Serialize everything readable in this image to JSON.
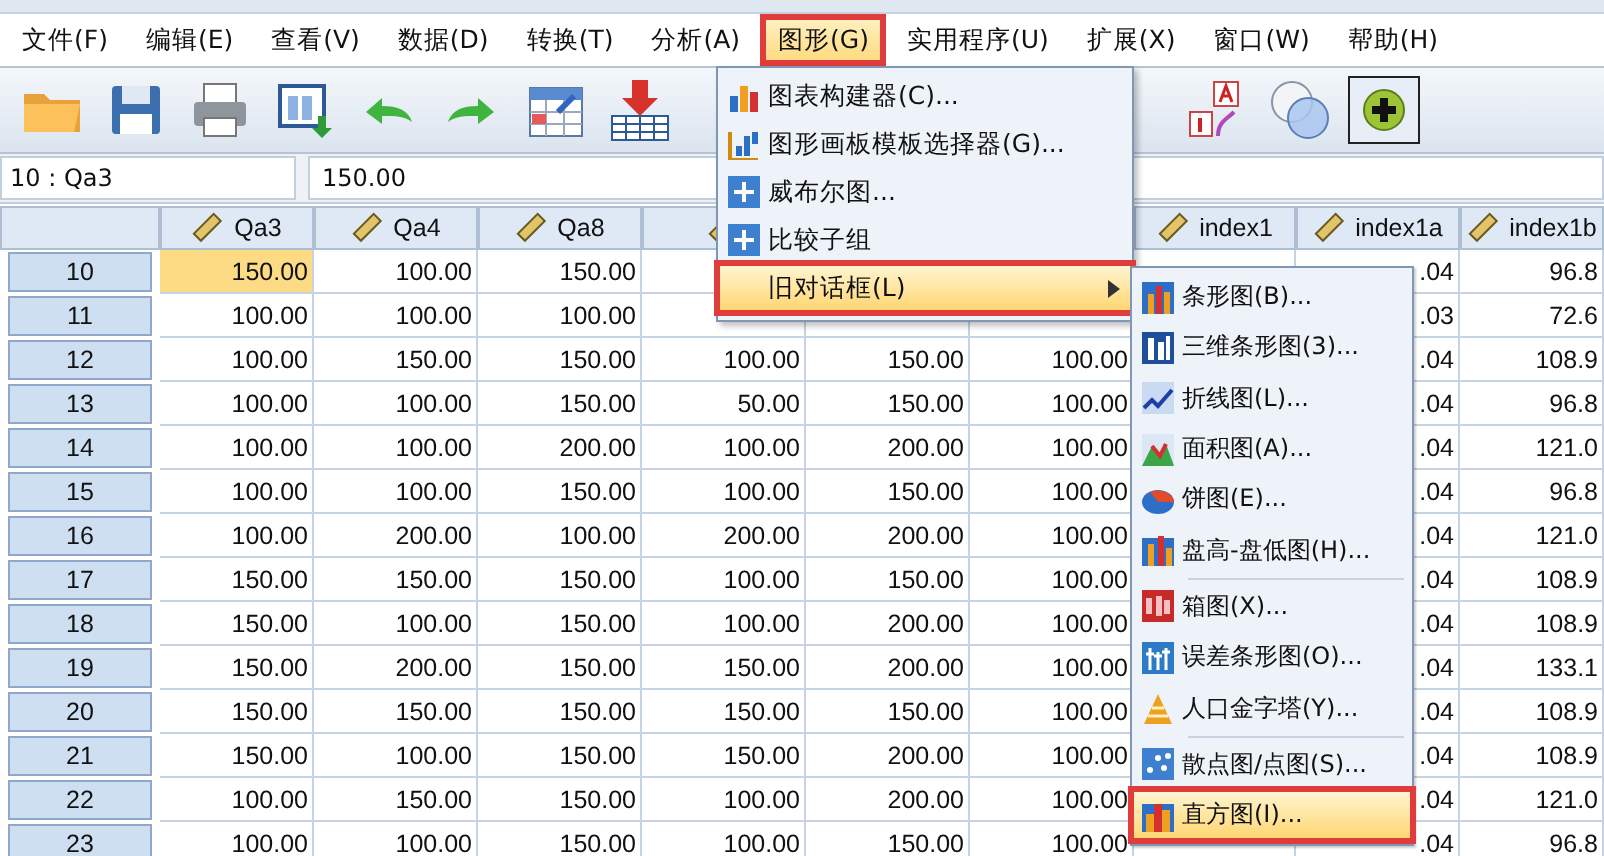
{
  "menu_bar": [
    {
      "label": "文件(F)",
      "selected": false,
      "outlined": false
    },
    {
      "label": "编辑(E)",
      "selected": false,
      "outlined": false
    },
    {
      "label": "查看(V)",
      "selected": false,
      "outlined": false
    },
    {
      "label": "数据(D)",
      "selected": false,
      "outlined": false
    },
    {
      "label": "转换(T)",
      "selected": false,
      "outlined": false
    },
    {
      "label": "分析(A)",
      "selected": false,
      "outlined": false
    },
    {
      "label": "图形(G)",
      "selected": true,
      "outlined": true
    },
    {
      "label": "实用程序(U)",
      "selected": false,
      "outlined": false
    },
    {
      "label": "扩展(X)",
      "selected": false,
      "outlined": false
    },
    {
      "label": "窗口(W)",
      "selected": false,
      "outlined": false
    },
    {
      "label": "帮助(H)",
      "selected": false,
      "outlined": false
    }
  ],
  "toolbar": {
    "add_on_pressed": true
  },
  "cell_bar": {
    "reference": "10 : Qa3",
    "value": "150.00"
  },
  "table": {
    "columns": [
      "Qa3",
      "Qa4",
      "Qa8",
      null,
      null,
      null,
      "index1",
      "index1a",
      "index1b"
    ],
    "rows": [
      {
        "label": "10",
        "cells": [
          {
            "text": "150.00",
            "selected": true
          },
          {
            "text": "100.00",
            "selected": false
          },
          {
            "text": "150.00",
            "selected": false
          },
          null,
          null,
          null,
          null,
          {
            "text": ".04",
            "selected": false
          },
          {
            "text": "96.8",
            "selected": false
          }
        ]
      },
      {
        "label": "11",
        "cells": [
          {
            "text": "100.00",
            "selected": false
          },
          {
            "text": "100.00",
            "selected": false
          },
          {
            "text": "100.00",
            "selected": false
          },
          null,
          null,
          null,
          null,
          {
            "text": ".03",
            "selected": false
          },
          {
            "text": "72.6",
            "selected": false
          }
        ]
      },
      {
        "label": "12",
        "cells": [
          {
            "text": "100.00",
            "selected": false
          },
          {
            "text": "150.00",
            "selected": false
          },
          {
            "text": "150.00",
            "selected": false
          },
          {
            "text": "100.00",
            "selected": false
          },
          {
            "text": "150.00",
            "selected": false
          },
          {
            "text": "100.00",
            "selected": false
          },
          null,
          {
            "text": ".04",
            "selected": false
          },
          {
            "text": "108.9",
            "selected": false
          }
        ]
      },
      {
        "label": "13",
        "cells": [
          {
            "text": "100.00",
            "selected": false
          },
          {
            "text": "100.00",
            "selected": false
          },
          {
            "text": "150.00",
            "selected": false
          },
          {
            "text": "50.00",
            "selected": false
          },
          {
            "text": "150.00",
            "selected": false
          },
          {
            "text": "100.00",
            "selected": false
          },
          null,
          {
            "text": ".04",
            "selected": false
          },
          {
            "text": "96.8",
            "selected": false
          }
        ]
      },
      {
        "label": "14",
        "cells": [
          {
            "text": "100.00",
            "selected": false
          },
          {
            "text": "100.00",
            "selected": false
          },
          {
            "text": "200.00",
            "selected": false
          },
          {
            "text": "100.00",
            "selected": false
          },
          {
            "text": "200.00",
            "selected": false
          },
          {
            "text": "100.00",
            "selected": false
          },
          null,
          {
            "text": ".04",
            "selected": false
          },
          {
            "text": "121.0",
            "selected": false
          }
        ]
      },
      {
        "label": "15",
        "cells": [
          {
            "text": "100.00",
            "selected": false
          },
          {
            "text": "100.00",
            "selected": false
          },
          {
            "text": "150.00",
            "selected": false
          },
          {
            "text": "100.00",
            "selected": false
          },
          {
            "text": "150.00",
            "selected": false
          },
          {
            "text": "100.00",
            "selected": false
          },
          null,
          {
            "text": ".04",
            "selected": false
          },
          {
            "text": "96.8",
            "selected": false
          }
        ]
      },
      {
        "label": "16",
        "cells": [
          {
            "text": "100.00",
            "selected": false
          },
          {
            "text": "200.00",
            "selected": false
          },
          {
            "text": "100.00",
            "selected": false
          },
          {
            "text": "200.00",
            "selected": false
          },
          {
            "text": "200.00",
            "selected": false
          },
          {
            "text": "100.00",
            "selected": false
          },
          null,
          {
            "text": ".04",
            "selected": false
          },
          {
            "text": "121.0",
            "selected": false
          }
        ]
      },
      {
        "label": "17",
        "cells": [
          {
            "text": "150.00",
            "selected": false
          },
          {
            "text": "150.00",
            "selected": false
          },
          {
            "text": "150.00",
            "selected": false
          },
          {
            "text": "100.00",
            "selected": false
          },
          {
            "text": "150.00",
            "selected": false
          },
          {
            "text": "100.00",
            "selected": false
          },
          null,
          {
            "text": ".04",
            "selected": false
          },
          {
            "text": "108.9",
            "selected": false
          }
        ]
      },
      {
        "label": "18",
        "cells": [
          {
            "text": "150.00",
            "selected": false
          },
          {
            "text": "100.00",
            "selected": false
          },
          {
            "text": "150.00",
            "selected": false
          },
          {
            "text": "100.00",
            "selected": false
          },
          {
            "text": "200.00",
            "selected": false
          },
          {
            "text": "100.00",
            "selected": false
          },
          null,
          {
            "text": ".04",
            "selected": false
          },
          {
            "text": "108.9",
            "selected": false
          }
        ]
      },
      {
        "label": "19",
        "cells": [
          {
            "text": "150.00",
            "selected": false
          },
          {
            "text": "200.00",
            "selected": false
          },
          {
            "text": "150.00",
            "selected": false
          },
          {
            "text": "150.00",
            "selected": false
          },
          {
            "text": "200.00",
            "selected": false
          },
          {
            "text": "100.00",
            "selected": false
          },
          null,
          {
            "text": ".04",
            "selected": false
          },
          {
            "text": "133.1",
            "selected": false
          }
        ]
      },
      {
        "label": "20",
        "cells": [
          {
            "text": "150.00",
            "selected": false
          },
          {
            "text": "150.00",
            "selected": false
          },
          {
            "text": "150.00",
            "selected": false
          },
          {
            "text": "150.00",
            "selected": false
          },
          {
            "text": "150.00",
            "selected": false
          },
          {
            "text": "100.00",
            "selected": false
          },
          null,
          {
            "text": ".04",
            "selected": false
          },
          {
            "text": "108.9",
            "selected": false
          }
        ]
      },
      {
        "label": "21",
        "cells": [
          {
            "text": "150.00",
            "selected": false
          },
          {
            "text": "100.00",
            "selected": false
          },
          {
            "text": "150.00",
            "selected": false
          },
          {
            "text": "150.00",
            "selected": false
          },
          {
            "text": "200.00",
            "selected": false
          },
          {
            "text": "100.00",
            "selected": false
          },
          null,
          {
            "text": ".04",
            "selected": false
          },
          {
            "text": "108.9",
            "selected": false
          }
        ]
      },
      {
        "label": "22",
        "cells": [
          {
            "text": "100.00",
            "selected": false
          },
          {
            "text": "150.00",
            "selected": false
          },
          {
            "text": "150.00",
            "selected": false
          },
          {
            "text": "100.00",
            "selected": false
          },
          {
            "text": "200.00",
            "selected": false
          },
          {
            "text": "100.00",
            "selected": false
          },
          null,
          {
            "text": ".04",
            "selected": false
          },
          {
            "text": "121.0",
            "selected": false
          }
        ]
      },
      {
        "label": "23",
        "cells": [
          {
            "text": "100.00",
            "selected": false
          },
          {
            "text": "100.00",
            "selected": false
          },
          {
            "text": "150.00",
            "selected": false
          },
          {
            "text": "100.00",
            "selected": false
          },
          {
            "text": "150.00",
            "selected": false
          },
          {
            "text": "100.00",
            "selected": false
          },
          null,
          {
            "text": ".04",
            "selected": false
          },
          {
            "text": "96.8",
            "selected": false
          }
        ]
      }
    ]
  },
  "graphs_menu": [
    {
      "label": "图表构建器(C)...",
      "kind": "item",
      "selected": false,
      "outlined": false
    },
    {
      "label": "图形画板模板选择器(G)...",
      "kind": "item",
      "selected": false,
      "outlined": false
    },
    {
      "label": "威布尔图...",
      "kind": "item",
      "selected": false,
      "outlined": false
    },
    {
      "label": "比较子组",
      "kind": "item",
      "selected": false,
      "outlined": false
    },
    {
      "label": "旧对话框(L)",
      "kind": "submenu",
      "selected": true,
      "outlined": true
    }
  ],
  "legacy_dialogs_menu": [
    {
      "label": "条形图(B)...",
      "selected": false,
      "outlined": false,
      "separator_before": false
    },
    {
      "label": "三维条形图(3)...",
      "selected": false,
      "outlined": false,
      "separator_before": false
    },
    {
      "label": "折线图(L)...",
      "selected": false,
      "outlined": false,
      "separator_before": false
    },
    {
      "label": "面积图(A)...",
      "selected": false,
      "outlined": false,
      "separator_before": false
    },
    {
      "label": "饼图(E)...",
      "selected": false,
      "outlined": false,
      "separator_before": false
    },
    {
      "label": "盘高-盘低图(H)...",
      "selected": false,
      "outlined": false,
      "separator_before": false
    },
    {
      "label": "箱图(X)...",
      "selected": false,
      "outlined": false,
      "separator_before": true
    },
    {
      "label": "误差条形图(O)...",
      "selected": false,
      "outlined": false,
      "separator_before": false
    },
    {
      "label": "人口金字塔(Y)...",
      "selected": false,
      "outlined": false,
      "separator_before": false
    },
    {
      "label": "散点图/点图(S)...",
      "selected": false,
      "outlined": false,
      "separator_before": true
    },
    {
      "label": "直方图(I)...",
      "selected": true,
      "outlined": true,
      "separator_before": false
    }
  ]
}
